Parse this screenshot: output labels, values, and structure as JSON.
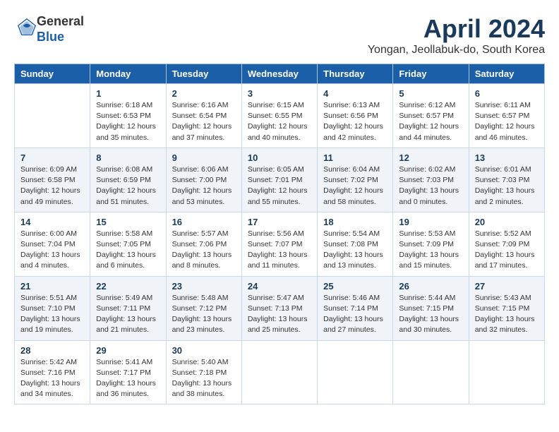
{
  "header": {
    "logo_line1": "General",
    "logo_line2": "Blue",
    "month_year": "April 2024",
    "location": "Yongan, Jeollabuk-do, South Korea"
  },
  "days_of_week": [
    "Sunday",
    "Monday",
    "Tuesday",
    "Wednesday",
    "Thursday",
    "Friday",
    "Saturday"
  ],
  "weeks": [
    [
      {
        "day": "",
        "info": ""
      },
      {
        "day": "1",
        "info": "Sunrise: 6:18 AM\nSunset: 6:53 PM\nDaylight: 12 hours\nand 35 minutes."
      },
      {
        "day": "2",
        "info": "Sunrise: 6:16 AM\nSunset: 6:54 PM\nDaylight: 12 hours\nand 37 minutes."
      },
      {
        "day": "3",
        "info": "Sunrise: 6:15 AM\nSunset: 6:55 PM\nDaylight: 12 hours\nand 40 minutes."
      },
      {
        "day": "4",
        "info": "Sunrise: 6:13 AM\nSunset: 6:56 PM\nDaylight: 12 hours\nand 42 minutes."
      },
      {
        "day": "5",
        "info": "Sunrise: 6:12 AM\nSunset: 6:57 PM\nDaylight: 12 hours\nand 44 minutes."
      },
      {
        "day": "6",
        "info": "Sunrise: 6:11 AM\nSunset: 6:57 PM\nDaylight: 12 hours\nand 46 minutes."
      }
    ],
    [
      {
        "day": "7",
        "info": "Sunrise: 6:09 AM\nSunset: 6:58 PM\nDaylight: 12 hours\nand 49 minutes."
      },
      {
        "day": "8",
        "info": "Sunrise: 6:08 AM\nSunset: 6:59 PM\nDaylight: 12 hours\nand 51 minutes."
      },
      {
        "day": "9",
        "info": "Sunrise: 6:06 AM\nSunset: 7:00 PM\nDaylight: 12 hours\nand 53 minutes."
      },
      {
        "day": "10",
        "info": "Sunrise: 6:05 AM\nSunset: 7:01 PM\nDaylight: 12 hours\nand 55 minutes."
      },
      {
        "day": "11",
        "info": "Sunrise: 6:04 AM\nSunset: 7:02 PM\nDaylight: 12 hours\nand 58 minutes."
      },
      {
        "day": "12",
        "info": "Sunrise: 6:02 AM\nSunset: 7:03 PM\nDaylight: 13 hours\nand 0 minutes."
      },
      {
        "day": "13",
        "info": "Sunrise: 6:01 AM\nSunset: 7:03 PM\nDaylight: 13 hours\nand 2 minutes."
      }
    ],
    [
      {
        "day": "14",
        "info": "Sunrise: 6:00 AM\nSunset: 7:04 PM\nDaylight: 13 hours\nand 4 minutes."
      },
      {
        "day": "15",
        "info": "Sunrise: 5:58 AM\nSunset: 7:05 PM\nDaylight: 13 hours\nand 6 minutes."
      },
      {
        "day": "16",
        "info": "Sunrise: 5:57 AM\nSunset: 7:06 PM\nDaylight: 13 hours\nand 8 minutes."
      },
      {
        "day": "17",
        "info": "Sunrise: 5:56 AM\nSunset: 7:07 PM\nDaylight: 13 hours\nand 11 minutes."
      },
      {
        "day": "18",
        "info": "Sunrise: 5:54 AM\nSunset: 7:08 PM\nDaylight: 13 hours\nand 13 minutes."
      },
      {
        "day": "19",
        "info": "Sunrise: 5:53 AM\nSunset: 7:09 PM\nDaylight: 13 hours\nand 15 minutes."
      },
      {
        "day": "20",
        "info": "Sunrise: 5:52 AM\nSunset: 7:09 PM\nDaylight: 13 hours\nand 17 minutes."
      }
    ],
    [
      {
        "day": "21",
        "info": "Sunrise: 5:51 AM\nSunset: 7:10 PM\nDaylight: 13 hours\nand 19 minutes."
      },
      {
        "day": "22",
        "info": "Sunrise: 5:49 AM\nSunset: 7:11 PM\nDaylight: 13 hours\nand 21 minutes."
      },
      {
        "day": "23",
        "info": "Sunrise: 5:48 AM\nSunset: 7:12 PM\nDaylight: 13 hours\nand 23 minutes."
      },
      {
        "day": "24",
        "info": "Sunrise: 5:47 AM\nSunset: 7:13 PM\nDaylight: 13 hours\nand 25 minutes."
      },
      {
        "day": "25",
        "info": "Sunrise: 5:46 AM\nSunset: 7:14 PM\nDaylight: 13 hours\nand 27 minutes."
      },
      {
        "day": "26",
        "info": "Sunrise: 5:44 AM\nSunset: 7:15 PM\nDaylight: 13 hours\nand 30 minutes."
      },
      {
        "day": "27",
        "info": "Sunrise: 5:43 AM\nSunset: 7:15 PM\nDaylight: 13 hours\nand 32 minutes."
      }
    ],
    [
      {
        "day": "28",
        "info": "Sunrise: 5:42 AM\nSunset: 7:16 PM\nDaylight: 13 hours\nand 34 minutes."
      },
      {
        "day": "29",
        "info": "Sunrise: 5:41 AM\nSunset: 7:17 PM\nDaylight: 13 hours\nand 36 minutes."
      },
      {
        "day": "30",
        "info": "Sunrise: 5:40 AM\nSunset: 7:18 PM\nDaylight: 13 hours\nand 38 minutes."
      },
      {
        "day": "",
        "info": ""
      },
      {
        "day": "",
        "info": ""
      },
      {
        "day": "",
        "info": ""
      },
      {
        "day": "",
        "info": ""
      }
    ]
  ]
}
